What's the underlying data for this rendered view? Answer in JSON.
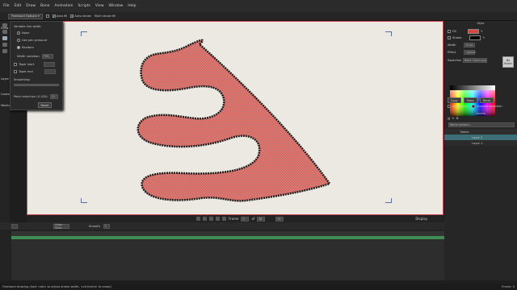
{
  "menu": [
    "File",
    "Edit",
    "Draw",
    "Bone",
    "Animation",
    "Scripts",
    "View",
    "Window",
    "Help"
  ],
  "options_bar": {
    "freehand_options": "Freehand Options",
    "auto_fill": "Auto fill",
    "auto_stroke": "Auto stroke",
    "multi_stroke_fill": "Multi stroke fill"
  },
  "popup": {
    "title": "Variable line width:",
    "none": "None",
    "use_pen_pressure": "Use pen pressure",
    "random": "Random",
    "width_variation_label": "Width variation:",
    "width_variation_value": "75%",
    "taper_start": "Taper start",
    "taper_end": "Taper end",
    "smoothing": "Smoothing:",
    "point_reduction_label": "Point reduction (0-100):",
    "point_reduction_value": "15",
    "reset": "Reset"
  },
  "left_labels": [
    "Draw",
    "Layer",
    "Camera",
    "Works"
  ],
  "style_panel": {
    "title": "Style",
    "fill_label": "Fill",
    "stroke_label": "Stroke",
    "width_label": "Width",
    "width_value": "10 px",
    "effect_label": "Effect",
    "effect_value": "<plain>",
    "no_brush": "No Brush",
    "swatches_label": "Swatches",
    "swatches_value": "Basic Colors.png",
    "copy": "Copy",
    "paste": "Paste",
    "reset": "Reset",
    "advanced": "Advanced",
    "checker_selection": "Checker selection",
    "fill_color": "#d9473f",
    "stroke_color": "#000000"
  },
  "layers_panel": {
    "title": "Layers",
    "search_placeholder": "Name contains...",
    "name_header": "Name",
    "layers": [
      "Layer 2",
      "Layer 1"
    ]
  },
  "view_bar": {
    "frame_label": "Frame",
    "frame_value": "0",
    "of_label": "of",
    "frame_total": "48",
    "fps": "24",
    "display": "Display"
  },
  "timeline": {
    "smooth": "Smooth",
    "ease_value": "1",
    "onion_label": "Onion Skins"
  },
  "status": {
    "message": "Freehand drawing (hold <alt> to adjust stroke width, <ctrl/cmd> to erase)",
    "right": "Frame: 0"
  },
  "accent_colors": {
    "canvas_border": "#d24b55",
    "shape_fill": "#e06c66",
    "keyframe_green": "#3f8d52",
    "selected_layer": "#3b6e76"
  }
}
